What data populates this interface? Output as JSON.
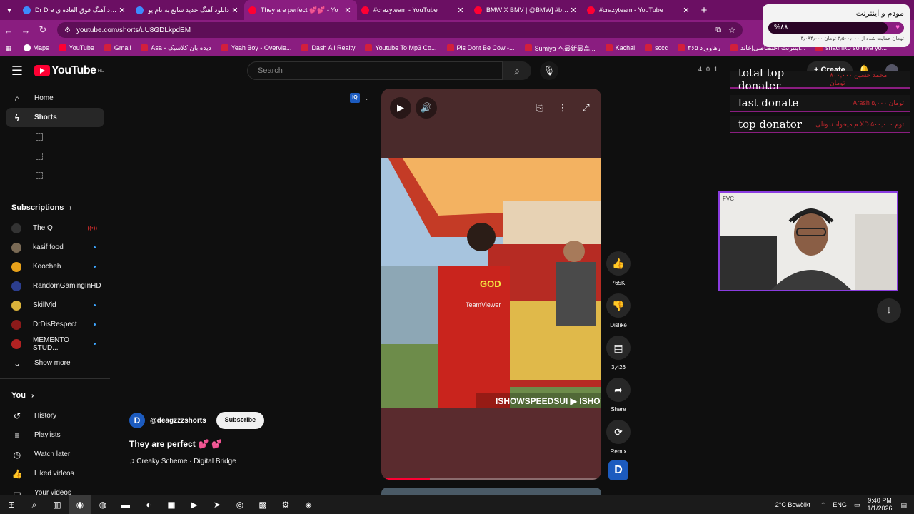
{
  "browser": {
    "tabs": [
      {
        "title": "Dr Dre دانلود آهنگ فوق العاده ی",
        "active": false
      },
      {
        "title": "دانلود آهنگ جدید شایع به نام یو",
        "active": false
      },
      {
        "title": "They are perfect 💕💕 - Yo",
        "active": true
      },
      {
        "title": "#crazyteam - YouTube",
        "active": false
      },
      {
        "title": "BMW X BMV | @BMW] #bmw",
        "active": false
      },
      {
        "title": "#crazyteam - YouTube",
        "active": false
      }
    ],
    "url": "youtube.com/shorts/uU8GDLkpdEM",
    "bookmarks": [
      "Maps",
      "YouTube",
      "Gmail",
      "Asa - دیده بان کلاسیک",
      "Yeah Boy - Overvie...",
      "Dash Ali Realty",
      "Youtube To Mp3 Co...",
      "Pls Dont Be Cow -...",
      "Sumiya ヘ最新最高...",
      "Kachal",
      "sccc",
      "رها‌وورد ۳۶۵",
      "اینترنت اختصاصی|خاند...",
      "shachiko son wa yo..."
    ]
  },
  "modem": {
    "title": "مودم و اینترنت",
    "percent_label": "%۸۸",
    "level": 0.88,
    "subtitle": "۳٫۰۹۴٫۰۰۰ تومان حمایت شده از ۳٫۵۰۰٫۰۰۰ تومان"
  },
  "masthead": {
    "logo": "YouTube",
    "region": "RU",
    "search_placeholder": "Search",
    "stats": [
      "4",
      "0",
      "1"
    ],
    "create_label": "Create"
  },
  "sidebar": {
    "main": [
      {
        "label": "Home",
        "icon": "home-icon",
        "glyph": "⌂"
      },
      {
        "label": "Shorts",
        "icon": "shorts-icon",
        "glyph": "ϟ"
      }
    ],
    "subscriptions_title": "Subscriptions",
    "subscriptions": [
      {
        "label": "The Q",
        "color": "#333333",
        "live": true
      },
      {
        "label": "kasif food",
        "color": "#7a6a55",
        "live": false
      },
      {
        "label": "Koocheh",
        "color": "#e7a11a",
        "live": false
      },
      {
        "label": "RandomGamingInHD",
        "color": "#2c3e8f",
        "live": false
      },
      {
        "label": "SkillVid",
        "color": "#d9b23b",
        "live": false
      },
      {
        "label": "DrDisRespect",
        "color": "#8b1a1a",
        "live": false
      },
      {
        "label": "MEMENTO STUD...",
        "color": "#b22222",
        "live": false
      }
    ],
    "show_more": "Show more",
    "you_title": "You",
    "you_items": [
      {
        "label": "History",
        "icon": "history-icon",
        "glyph": "↺"
      },
      {
        "label": "Playlists",
        "icon": "playlists-icon",
        "glyph": "≡"
      },
      {
        "label": "Watch later",
        "icon": "watch-later-icon",
        "glyph": "◷"
      },
      {
        "label": "Liked videos",
        "icon": "liked-icon",
        "glyph": "👍"
      },
      {
        "label": "Your videos",
        "icon": "your-videos-icon",
        "glyph": "▭"
      }
    ]
  },
  "short": {
    "channel_handle": "@deagzzzshorts",
    "subscribe_label": "Subscribe",
    "title": "They are perfect",
    "title_emoji": "💕 💕",
    "audio": "♫ Creaky Scheme · Digital Bridge",
    "progress": 0.22
  },
  "actions": [
    {
      "name": "like",
      "icon": "thumbs-up-icon",
      "glyph": "👍",
      "label": "765K"
    },
    {
      "name": "dislike",
      "icon": "thumbs-down-icon",
      "glyph": "👎",
      "label": "Dislike"
    },
    {
      "name": "comments",
      "icon": "comment-icon",
      "glyph": "▤",
      "label": "3,426"
    },
    {
      "name": "share",
      "icon": "share-icon",
      "glyph": "➦",
      "label": "Share"
    },
    {
      "name": "remix",
      "icon": "remix-icon",
      "glyph": "⟳",
      "label": "Remix"
    }
  ],
  "overlay": {
    "total_top": {
      "label": "total top donater",
      "value": "محمد حسین ۸۰۰,۰۰۰ تومان"
    },
    "last_donate": {
      "label": "last donate",
      "value": "Arash ۵,۰۰۰ تومان"
    },
    "top_donator": {
      "label": "top donator",
      "value": "م میخواد ندونلی XD ۵۰۰,۰۰۰ توم"
    }
  },
  "taskbar": {
    "weather": "2°C Bewölkt",
    "lang": "ENG",
    "time": "9:40 PM",
    "date": "1/1/2026"
  },
  "colors": {
    "accent": "#8a1d80",
    "yt_red": "#ff0033"
  }
}
